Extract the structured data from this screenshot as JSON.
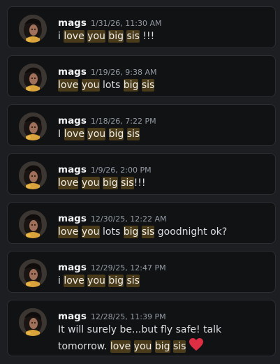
{
  "messages": [
    {
      "author": "mags",
      "timestamp": "1/31/26, 11:30 AM",
      "avatar_icon": "avatar-image",
      "segments": [
        {
          "text": "i ",
          "hl": false
        },
        {
          "text": "love",
          "hl": true
        },
        {
          "text": " ",
          "hl": false
        },
        {
          "text": "you",
          "hl": true
        },
        {
          "text": " ",
          "hl": false
        },
        {
          "text": "big",
          "hl": true
        },
        {
          "text": " ",
          "hl": false
        },
        {
          "text": "sis",
          "hl": true
        },
        {
          "text": " !!!",
          "hl": false
        }
      ]
    },
    {
      "author": "mags",
      "timestamp": "1/19/26, 9:38 AM",
      "avatar_icon": "avatar-image",
      "segments": [
        {
          "text": "love",
          "hl": true
        },
        {
          "text": " ",
          "hl": false
        },
        {
          "text": "you",
          "hl": true
        },
        {
          "text": " lots ",
          "hl": false
        },
        {
          "text": "big",
          "hl": true
        },
        {
          "text": " ",
          "hl": false
        },
        {
          "text": "sis",
          "hl": true
        }
      ]
    },
    {
      "author": "mags",
      "timestamp": "1/18/26, 7:22 PM",
      "avatar_icon": "avatar-image",
      "segments": [
        {
          "text": "I ",
          "hl": false
        },
        {
          "text": "love",
          "hl": true
        },
        {
          "text": " ",
          "hl": false
        },
        {
          "text": "you",
          "hl": true
        },
        {
          "text": " ",
          "hl": false
        },
        {
          "text": "big",
          "hl": true
        },
        {
          "text": " ",
          "hl": false
        },
        {
          "text": "sis",
          "hl": true
        }
      ]
    },
    {
      "author": "mags",
      "timestamp": "1/9/26, 2:00 PM",
      "avatar_icon": "avatar-image",
      "segments": [
        {
          "text": "love",
          "hl": true
        },
        {
          "text": " ",
          "hl": false
        },
        {
          "text": "you",
          "hl": true
        },
        {
          "text": " ",
          "hl": false
        },
        {
          "text": "big",
          "hl": true
        },
        {
          "text": " ",
          "hl": false
        },
        {
          "text": "sis",
          "hl": true
        },
        {
          "text": "!!!",
          "hl": false
        }
      ]
    },
    {
      "author": "mags",
      "timestamp": "12/30/25, 12:22 AM",
      "avatar_icon": "avatar-image",
      "segments": [
        {
          "text": "love",
          "hl": true
        },
        {
          "text": " ",
          "hl": false
        },
        {
          "text": "you",
          "hl": true
        },
        {
          "text": " lots ",
          "hl": false
        },
        {
          "text": "big",
          "hl": true
        },
        {
          "text": " ",
          "hl": false
        },
        {
          "text": "sis",
          "hl": true
        },
        {
          "text": " goodnight ok?",
          "hl": false
        }
      ]
    },
    {
      "author": "mags",
      "timestamp": "12/29/25, 12:47 PM",
      "avatar_icon": "avatar-image",
      "segments": [
        {
          "text": "i ",
          "hl": false
        },
        {
          "text": "love",
          "hl": true
        },
        {
          "text": " ",
          "hl": false
        },
        {
          "text": "you",
          "hl": true
        },
        {
          "text": " ",
          "hl": false
        },
        {
          "text": "big",
          "hl": true
        },
        {
          "text": " ",
          "hl": false
        },
        {
          "text": "sis",
          "hl": true
        }
      ]
    },
    {
      "author": "mags",
      "timestamp": "12/28/25, 11:39 PM",
      "avatar_icon": "avatar-image",
      "emoji": "red-heart-icon",
      "segments": [
        {
          "text": "It will surely be...but fly safe! talk tomorrow. ",
          "hl": false
        },
        {
          "text": "love",
          "hl": true
        },
        {
          "text": " ",
          "hl": false
        },
        {
          "text": "you",
          "hl": true
        },
        {
          "text": " ",
          "hl": false
        },
        {
          "text": "big",
          "hl": true
        },
        {
          "text": " ",
          "hl": false
        },
        {
          "text": "sis",
          "hl": true
        }
      ]
    }
  ],
  "colors": {
    "background": "#1d1e22",
    "card": "#111214",
    "highlight": "#4a3b1a",
    "heart": "#dd2e44"
  }
}
